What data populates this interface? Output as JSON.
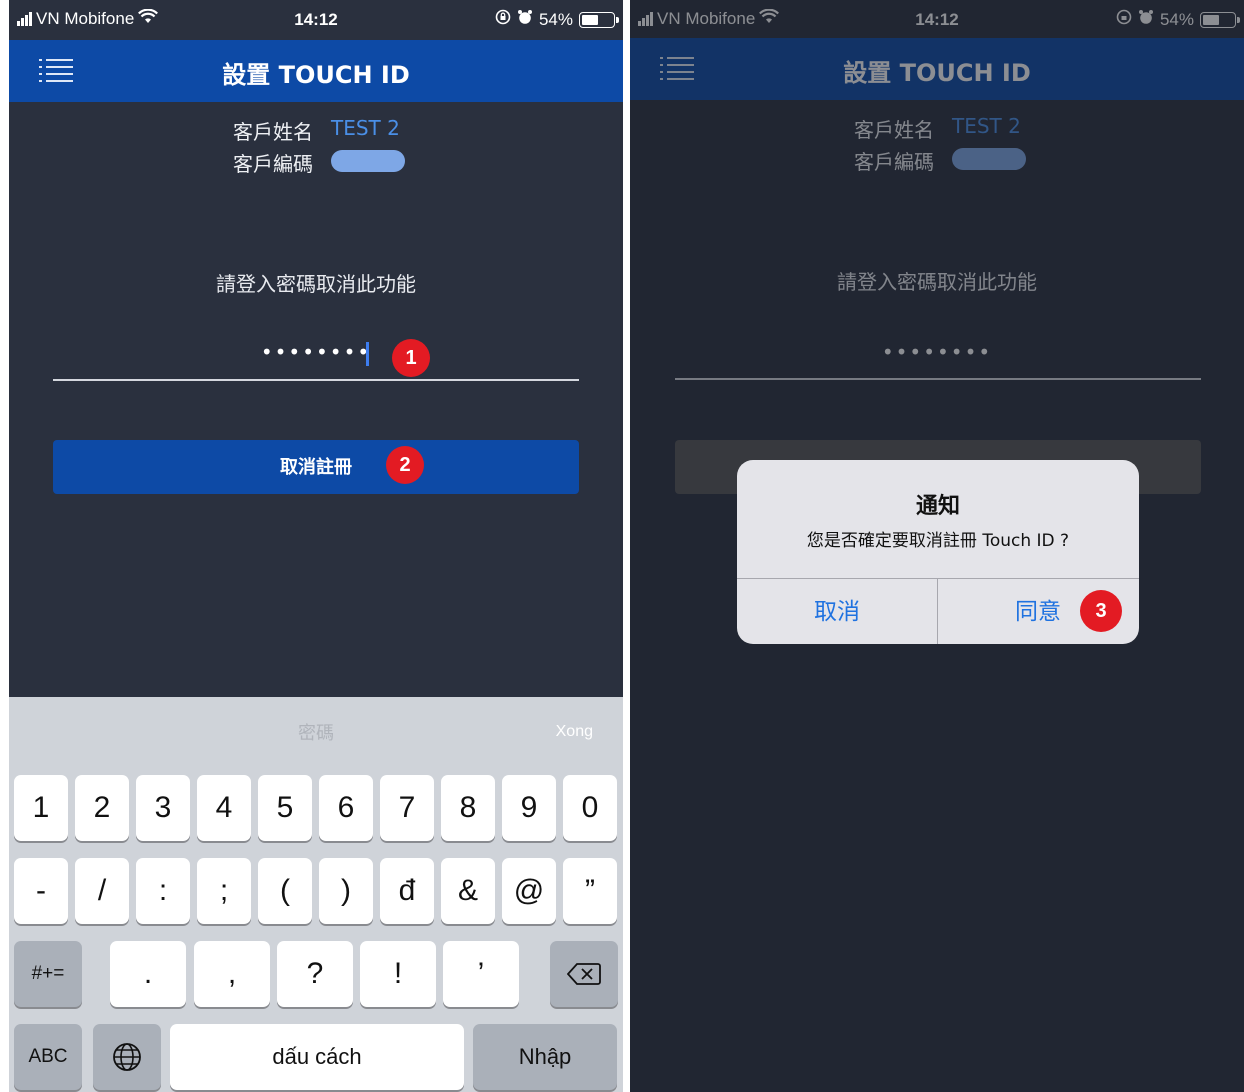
{
  "statusbar": {
    "carrier": "VN Mobifone",
    "time": "14:12",
    "battery": "54%",
    "battery_level": 0.54
  },
  "header": {
    "title": "設置 TOUCH ID",
    "menu_icon": "hamburger-menu-icon"
  },
  "customer": {
    "name_label": "客戶姓名",
    "name_value": "TEST 2",
    "id_label": "客戶編碼"
  },
  "form": {
    "prompt": "請登入密碼取消此功能",
    "password_masked": "••••••••",
    "button_label": "取消註冊"
  },
  "steps": [
    "1",
    "2",
    "3"
  ],
  "keyboard": {
    "placeholder": "密碼",
    "done": "Xong",
    "row1": [
      "1",
      "2",
      "3",
      "4",
      "5",
      "6",
      "7",
      "8",
      "9",
      "0"
    ],
    "row2": [
      "-",
      "/",
      ":",
      ";",
      "(",
      ")",
      "đ",
      "&",
      "@",
      "”"
    ],
    "symbols_key": "#+=",
    "row3": [
      ".",
      ",",
      "?",
      "!",
      "’"
    ],
    "abc_key": "ABC",
    "space": "dấu cách",
    "return": "Nhập"
  },
  "dialog": {
    "title": "通知",
    "message": "您是否確定要取消註冊 Touch ID ?",
    "cancel": "取消",
    "agree": "同意"
  },
  "colors": {
    "header_blue": "#0d4aa6",
    "background": "#2a303e",
    "accent_link": "#4a8fe7",
    "badge_red": "#e31b23",
    "dialog_button": "#1f72e0"
  }
}
